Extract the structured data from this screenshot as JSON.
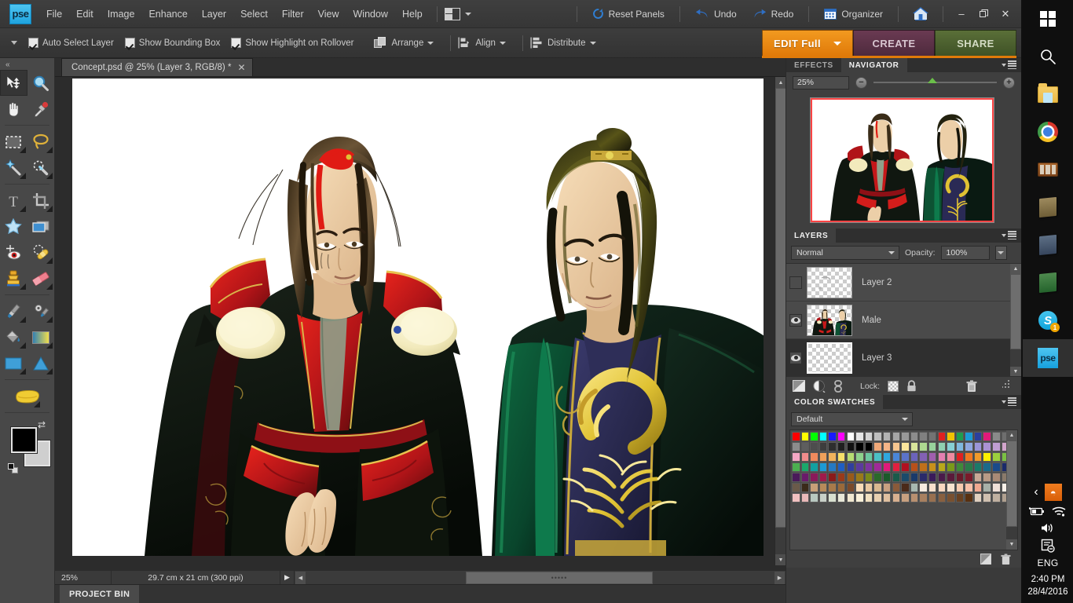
{
  "app": {
    "logo_text": "pse",
    "menus": [
      "File",
      "Edit",
      "Image",
      "Enhance",
      "Layer",
      "Select",
      "Filter",
      "View",
      "Window",
      "Help"
    ],
    "arrange_icon": "window-arrange-icon",
    "right_actions": [
      {
        "label": "Reset Panels",
        "icon": "reset-icon"
      },
      {
        "label": "Undo",
        "icon": "undo-icon"
      },
      {
        "label": "Redo",
        "icon": "redo-icon"
      },
      {
        "label": "Organizer",
        "icon": "organizer-icon"
      },
      {
        "label": "Home",
        "icon": "home-icon"
      }
    ],
    "window_controls": {
      "minimize": "–",
      "maximize": "❐",
      "close": "✕"
    }
  },
  "options_bar": {
    "checkboxes": [
      {
        "label": "Auto Select Layer",
        "checked": true
      },
      {
        "label": "Show Bounding Box",
        "checked": true
      },
      {
        "label": "Show Highlight on Rollover",
        "checked": true
      }
    ],
    "buttons": [
      {
        "label": "Arrange",
        "icon": "arrange-icon"
      },
      {
        "label": "Align",
        "icon": "align-icon"
      },
      {
        "label": "Distribute",
        "icon": "distribute-icon"
      }
    ]
  },
  "mode_tabs": [
    {
      "label": "EDIT Full",
      "active": true,
      "color": "#e07a09"
    },
    {
      "label": "CREATE",
      "active": false,
      "color": "#4e2a3d"
    },
    {
      "label": "SHARE",
      "active": false,
      "color": "#3f5226"
    }
  ],
  "tools": [
    {
      "name": "move-tool",
      "active": true,
      "icon": "move-arrow"
    },
    {
      "name": "zoom-tool",
      "active": false,
      "icon": "magnifier"
    },
    {
      "name": "hand-tool",
      "active": false,
      "icon": "hand"
    },
    {
      "name": "eyedropper-tool",
      "active": false,
      "icon": "eyedropper"
    },
    {
      "name": "rectangular-marquee-tool",
      "active": false,
      "icon": "marquee"
    },
    {
      "name": "lasso-tool",
      "active": false,
      "icon": "lasso"
    },
    {
      "name": "magic-wand-tool",
      "active": false,
      "icon": "magic-wand"
    },
    {
      "name": "quick-selection-tool",
      "active": false,
      "icon": "quick-select"
    },
    {
      "name": "type-tool",
      "active": false,
      "icon": "type-T"
    },
    {
      "name": "crop-tool",
      "active": false,
      "icon": "crop"
    },
    {
      "name": "cookie-cutter-tool",
      "active": false,
      "icon": "star-cookie"
    },
    {
      "name": "straighten-tool",
      "active": false,
      "icon": "straighten"
    },
    {
      "name": "red-eye-removal-tool",
      "active": false,
      "icon": "red-eye"
    },
    {
      "name": "healing-brush-tool",
      "active": false,
      "icon": "bandage"
    },
    {
      "name": "clone-stamp-tool",
      "active": false,
      "icon": "stamp"
    },
    {
      "name": "eraser-tool",
      "active": false,
      "icon": "eraser"
    },
    {
      "name": "brush-tool",
      "active": false,
      "icon": "brush"
    },
    {
      "name": "smart-brush-tool",
      "active": false,
      "icon": "gear-brush"
    },
    {
      "name": "paint-bucket-tool",
      "active": false,
      "icon": "paint-bucket"
    },
    {
      "name": "gradient-tool",
      "active": false,
      "icon": "gradient"
    },
    {
      "name": "shape-tool",
      "active": false,
      "icon": "rectangle-shape"
    },
    {
      "name": "custom-shape-tool",
      "active": false,
      "icon": "triangle-shape"
    },
    {
      "name": "sponge-tool",
      "active": false,
      "icon": "sponge"
    }
  ],
  "color_wells": {
    "foreground": "#000000",
    "background": "#cfcfcf",
    "swap_icon": "swap-colors-icon",
    "default_icon": "default-colors-icon"
  },
  "document": {
    "tab_title": "Concept.psd @ 25% (Layer 3, RGB/8) *",
    "close_glyph": "✕"
  },
  "status_bar": {
    "zoom": "25%",
    "dimensions": "29.7 cm x 21 cm (300 ppi)",
    "play_glyph": "▶",
    "scroll_grip": "•••••"
  },
  "project_bin": {
    "label": "PROJECT BIN"
  },
  "navigator": {
    "tabs": [
      {
        "label": "EFFECTS",
        "active": false
      },
      {
        "label": "NAVIGATOR",
        "active": true
      }
    ],
    "zoom_value": "25%",
    "zoom_out_glyph": "−",
    "zoom_in_glyph": "+",
    "view_box_color": "#ff4444"
  },
  "layers": {
    "title": "LAYERS",
    "blend_mode": "Normal",
    "opacity_label": "Opacity:",
    "opacity_value": "100%",
    "rows": [
      {
        "name": "Layer 2",
        "visible": false,
        "selected": false,
        "thumb": "transparent"
      },
      {
        "name": "Male",
        "visible": true,
        "selected": false,
        "thumb": "artwork"
      },
      {
        "name": "Layer 3",
        "visible": true,
        "selected": true,
        "thumb": "transparent"
      }
    ],
    "toolbar": {
      "new_layer_icon": "new-layer-icon",
      "adjustment_layer_icon": "adjustment-layer-icon",
      "link_layers_icon": "link-layers-icon",
      "lock_label": "Lock:",
      "lock_transparency_icon": "lock-transparency-icon",
      "lock_all_icon": "lock-all-icon",
      "delete_layer_icon": "trash-icon"
    }
  },
  "color_swatches": {
    "title": "COLOR SWATCHES",
    "preset": "Default",
    "rows": [
      [
        "#ff0000",
        "#ffff00",
        "#00ff00",
        "#00ffff",
        "#1a1aff",
        "#ff00ff",
        "#ffffff",
        "#e6e6e6",
        "#d4d4d4",
        "#bfbfbf",
        "#b3b3b3",
        "#a6a6a6",
        "#999999",
        "#8c8c8c",
        "#808080",
        "#737373",
        "#e02020",
        "#f2c200",
        "#1f9d4f",
        "#1c9ad6",
        "#2b3f9e",
        "#e01a7a",
        "#8a8a8a",
        "#6e6e6e"
      ],
      [
        "#8c8c8c",
        "#5e5e5e",
        "#4d4d4d",
        "#3d3d3d",
        "#2e2e2e",
        "#1f1f1f",
        "#111111",
        "#000000",
        "#000000",
        "#f0a878",
        "#f5b487",
        "#f7c68f",
        "#fae59b",
        "#d8e59a",
        "#add890",
        "#97d29b",
        "#8fd0b0",
        "#86cfd4",
        "#7fb8e0",
        "#8fa7e0",
        "#9b95d8",
        "#ab92d3",
        "#bf9ed2",
        "#d2a5cc"
      ],
      [
        "#f4a7c4",
        "#f08c8c",
        "#f08a5d",
        "#f0a05a",
        "#f2b35c",
        "#f7e06a",
        "#b7dc72",
        "#8ed18c",
        "#6dc7a0",
        "#4bbfc5",
        "#2fa8e0",
        "#4a86d8",
        "#5b73c9",
        "#6b63bb",
        "#8361b4",
        "#a05fae",
        "#e57fb0",
        "#f08aa0",
        "#e02020",
        "#f07820",
        "#f09a2a",
        "#fff000",
        "#9ccf3d",
        "#7bc043"
      ],
      [
        "#4caf50",
        "#1aa86b",
        "#12a0a0",
        "#1c9ad6",
        "#2579c4",
        "#1f5ec4",
        "#2f3f9e",
        "#5b3a9e",
        "#7e34a0",
        "#a02a98",
        "#e01a7a",
        "#e0203f",
        "#b01020",
        "#b8501a",
        "#c0701a",
        "#c8901a",
        "#b8a81a",
        "#7a9a1a",
        "#3f8a3a",
        "#2a7a4a",
        "#1a7a6a",
        "#1a6a8a",
        "#1a4a8a",
        "#1a2a6a"
      ],
      [
        "#4a1a5a",
        "#6a1a6a",
        "#8a1a5a",
        "#a01a4a",
        "#8a1a1a",
        "#9a3a1a",
        "#9a5a1a",
        "#9a7a1a",
        "#7a8a1a",
        "#2a6a2a",
        "#1a5a2a",
        "#1a5a4a",
        "#1a4a6a",
        "#1a3a6a",
        "#2a2a6a",
        "#3a1a5a",
        "#4a1a4a",
        "#5a1a3a",
        "#6a1a2a",
        "#7a1a2a",
        "#c8a896",
        "#b89a86",
        "#a88a76",
        "#8a7a6a"
      ],
      [
        "#6a5a4a",
        "#3a2a1a",
        "#c8a078",
        "#b88a5a",
        "#a87a4a",
        "#9a6a3a",
        "#7a4a2a",
        "#f8dcb8",
        "#e8c8a0",
        "#d8b890",
        "#c8a080",
        "#8a5a3a",
        "#4a2a1a",
        "#a8b8b0",
        "#f8ece0",
        "#f8e0cc",
        "#f8d8c0",
        "#f8e4d0",
        "#f8ccb0",
        "#f8c0a8",
        "#f0a890",
        "#a8b0a8",
        "#f0e0d8",
        "#f8f0e8"
      ],
      [
        "#f0c0c0",
        "#e8b8b8",
        "#b8c8c0",
        "#c8d0c8",
        "#d8e0d0",
        "#e8e8d8",
        "#f0e8d0",
        "#f8f0d8",
        "#f0e0c0",
        "#e8d0b0",
        "#e0c0a0",
        "#d8b090",
        "#c8a080",
        "#b89070",
        "#a88060",
        "#987050",
        "#886040",
        "#785030",
        "#684020",
        "#583010",
        "#e0d0c0",
        "#d0c0b0",
        "#c0b0a0",
        "#b0a090"
      ]
    ]
  },
  "taskbar": {
    "items": [
      {
        "name": "start-button",
        "icon": "windows-logo"
      },
      {
        "name": "search-button",
        "icon": "search-icon"
      },
      {
        "name": "file-explorer",
        "icon": "folder-icon"
      },
      {
        "name": "google-chrome",
        "icon": "chrome-icon"
      },
      {
        "name": "media-player",
        "icon": "radio-icon"
      },
      {
        "name": "powerpoint",
        "icon": "book-p-icon"
      },
      {
        "name": "word",
        "icon": "book-w-icon"
      },
      {
        "name": "excel",
        "icon": "book-x-icon"
      },
      {
        "name": "skype",
        "icon": "skype-icon",
        "badge": "1"
      },
      {
        "name": "photoshop-elements",
        "icon": "pse-icon",
        "active": true
      }
    ],
    "tray": {
      "show_hidden_glyph": "‹",
      "java_icon": "java-icon",
      "battery_icon": "battery-icon",
      "wifi_icon": "wifi-icon",
      "volume_icon": "volume-icon",
      "action_center_icon": "action-center-icon",
      "language": "ENG",
      "time": "2:40 PM",
      "date": "28/4/2016"
    }
  },
  "artwork": {
    "description": "Two male character concept illustrations on white background",
    "left_figure": {
      "hair": "#2b2116",
      "hair_light": "#6b5436",
      "ribbon": "#e01b14",
      "robe_dark": "#121a12",
      "robe_red": "#b01418",
      "robe_red_bright": "#e3201c",
      "gold": "#d9b44a",
      "fur": "#f2ecc0",
      "skin": "#f0cfa8",
      "sash_green": "#8fa08a"
    },
    "right_figure": {
      "hair": "#17150e",
      "hair_light": "#6d6a25",
      "robe_green": "#0d5233",
      "robe_dark": "#0a1f15",
      "inner_navy": "#2a2a55",
      "gold": "#e0c233",
      "skin": "#e9c79a"
    }
  }
}
